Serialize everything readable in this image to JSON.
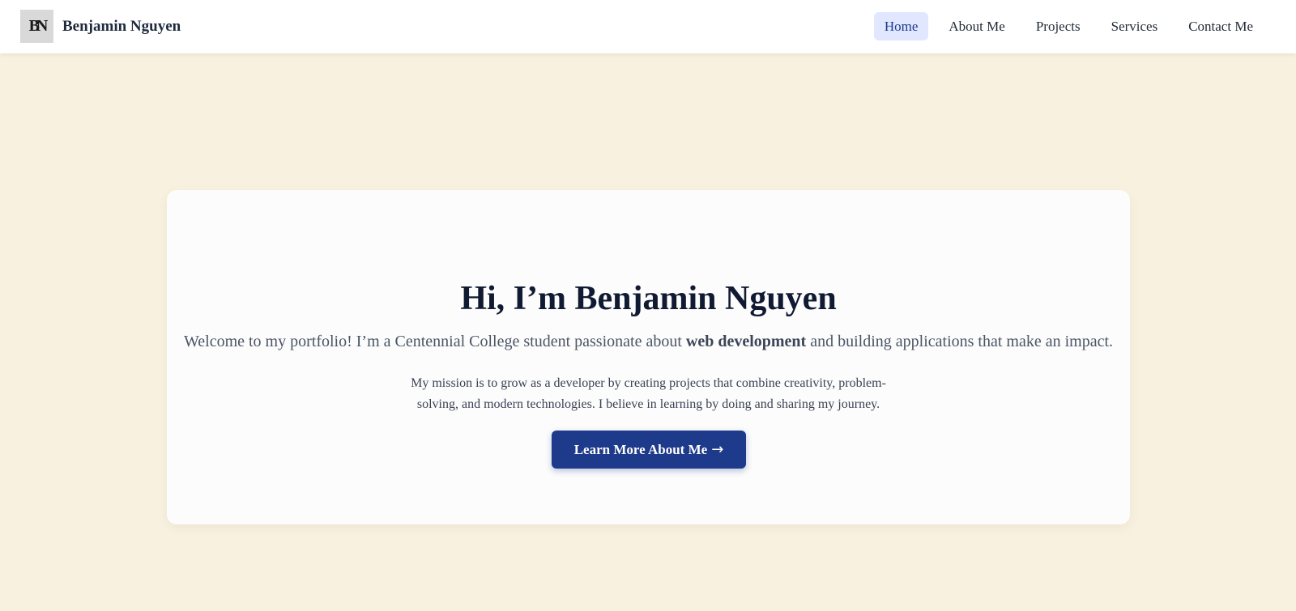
{
  "header": {
    "logo_text": "BN",
    "site_name": "Benjamin Nguyen",
    "nav": [
      {
        "label": "Home",
        "active": true
      },
      {
        "label": "About Me",
        "active": false
      },
      {
        "label": "Projects",
        "active": false
      },
      {
        "label": "Services",
        "active": false
      },
      {
        "label": "Contact Me",
        "active": false
      }
    ]
  },
  "hero": {
    "title": "Hi, I’m Benjamin Nguyen",
    "subtitle_before": "Welcome to my portfolio! I’m a Centennial College student passionate about ",
    "subtitle_emphasis": "web development",
    "subtitle_after": " and building applications that make an impact.",
    "mission": "My mission is to grow as a developer by creating projects that combine creativity, problem-solving, and modern technologies. I believe in learning by doing and sharing my journey.",
    "button_label": "Learn More About Me",
    "button_icon": "arrow-right-icon",
    "button_arrow": "→"
  },
  "colors": {
    "page_background": "#f8f1df",
    "accent": "#1e3a8a",
    "active_nav_background": "#e0e7ff"
  }
}
